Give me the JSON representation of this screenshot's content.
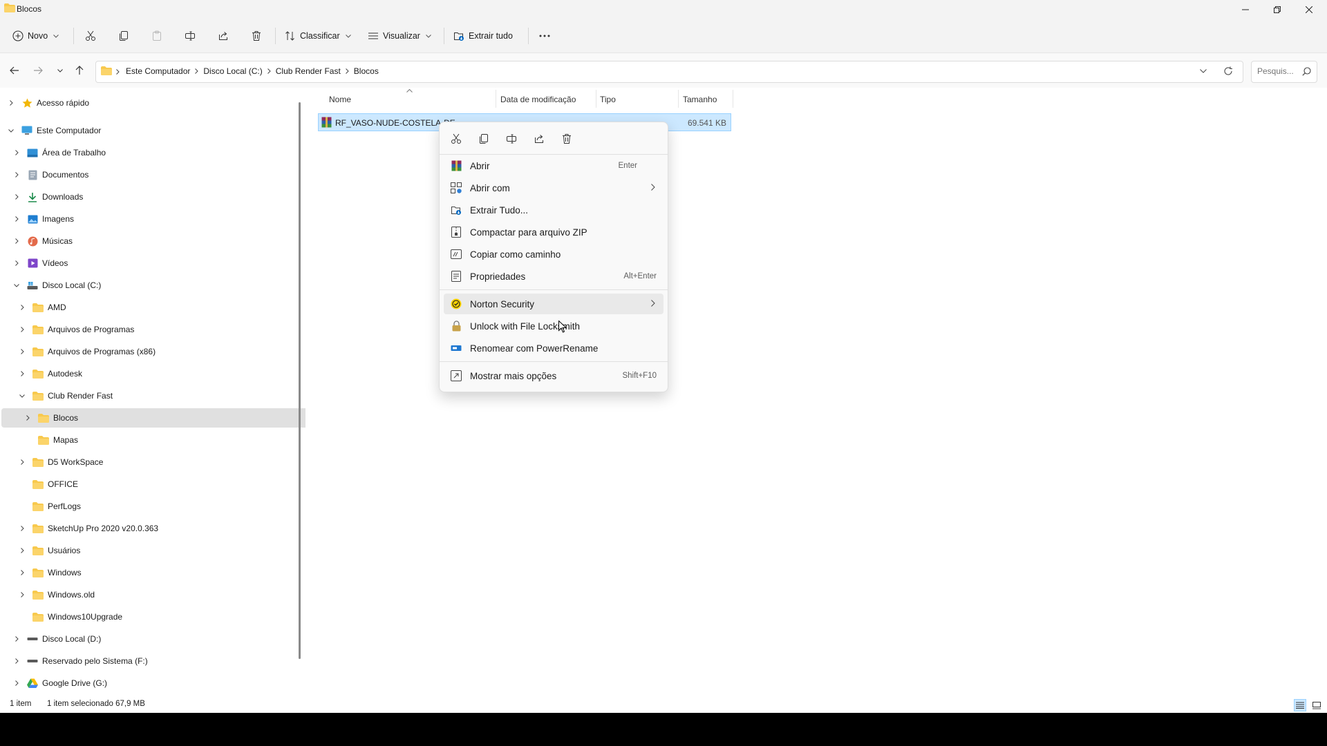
{
  "window": {
    "title": "Blocos"
  },
  "toolbar": {
    "new_label": "Novo",
    "sort_label": "Classificar",
    "view_label": "Visualizar",
    "extract_all_label": "Extrair tudo"
  },
  "address": {
    "crumbs": [
      "Este Computador",
      "Disco Local (C:)",
      "Club Render Fast",
      "Blocos"
    ],
    "search_placeholder": "Pesquis..."
  },
  "sidebar": {
    "items": [
      {
        "label": "Acesso rápido",
        "icon": "star-icon"
      },
      {
        "label": "Este Computador",
        "icon": "computer-icon"
      },
      {
        "label": "Área de Trabalho",
        "icon": "desktop-icon"
      },
      {
        "label": "Documentos",
        "icon": "documents-icon"
      },
      {
        "label": "Downloads",
        "icon": "download-icon"
      },
      {
        "label": "Imagens",
        "icon": "pictures-icon"
      },
      {
        "label": "Músicas",
        "icon": "music-icon"
      },
      {
        "label": "Vídeos",
        "icon": "videos-icon"
      },
      {
        "label": "Disco Local (C:)",
        "icon": "drive-c-icon"
      },
      {
        "label": "AMD",
        "icon": "folder-icon"
      },
      {
        "label": "Arquivos de Programas",
        "icon": "folder-icon"
      },
      {
        "label": "Arquivos de Programas (x86)",
        "icon": "folder-icon"
      },
      {
        "label": "Autodesk",
        "icon": "folder-icon"
      },
      {
        "label": "Club Render Fast",
        "icon": "folder-icon"
      },
      {
        "label": "Blocos",
        "icon": "folder-icon"
      },
      {
        "label": "Mapas",
        "icon": "folder-icon"
      },
      {
        "label": "D5 WorkSpace",
        "icon": "folder-icon"
      },
      {
        "label": "OFFICE",
        "icon": "folder-icon"
      },
      {
        "label": "PerfLogs",
        "icon": "folder-icon"
      },
      {
        "label": "SketchUp Pro 2020 v20.0.363",
        "icon": "folder-icon"
      },
      {
        "label": "Usuários",
        "icon": "folder-icon"
      },
      {
        "label": "Windows",
        "icon": "folder-icon"
      },
      {
        "label": "Windows.old",
        "icon": "folder-icon"
      },
      {
        "label": "Windows10Upgrade",
        "icon": "folder-icon"
      },
      {
        "label": "Disco Local (D:)",
        "icon": "drive-icon"
      },
      {
        "label": "Reservado pelo Sistema (F:)",
        "icon": "drive-icon"
      },
      {
        "label": "Google Drive (G:)",
        "icon": "google-drive-icon"
      }
    ]
  },
  "columns": {
    "name": "Nome",
    "modified": "Data de modificação",
    "type": "Tipo",
    "size": "Tamanho"
  },
  "file": {
    "name": "RF_VASO-NUDE-COSTELA-DE",
    "size": "69.541 KB"
  },
  "context_menu": {
    "items": [
      {
        "label": "Abrir",
        "shortcut": "Enter"
      },
      {
        "label": "Abrir com",
        "shortcut": ""
      },
      {
        "label": "Extrair Tudo...",
        "shortcut": ""
      },
      {
        "label": "Compactar para arquivo ZIP",
        "shortcut": ""
      },
      {
        "label": "Copiar como caminho",
        "shortcut": ""
      },
      {
        "label": "Propriedades",
        "shortcut": "Alt+Enter"
      },
      {
        "label": "Norton Security",
        "shortcut": ""
      },
      {
        "label": "Unlock with File Locksmith",
        "shortcut": ""
      },
      {
        "label": "Renomear com PowerRename",
        "shortcut": ""
      },
      {
        "label": "Mostrar mais opções",
        "shortcut": "Shift+F10"
      }
    ]
  },
  "status": {
    "count": "1 item",
    "selection": "1 item selecionado  67,9 MB"
  },
  "colors": {
    "accent": "#0067c0",
    "folder": "#f8c94d",
    "selected_row": "#cce8ff",
    "hover": "#e0e0e0"
  }
}
